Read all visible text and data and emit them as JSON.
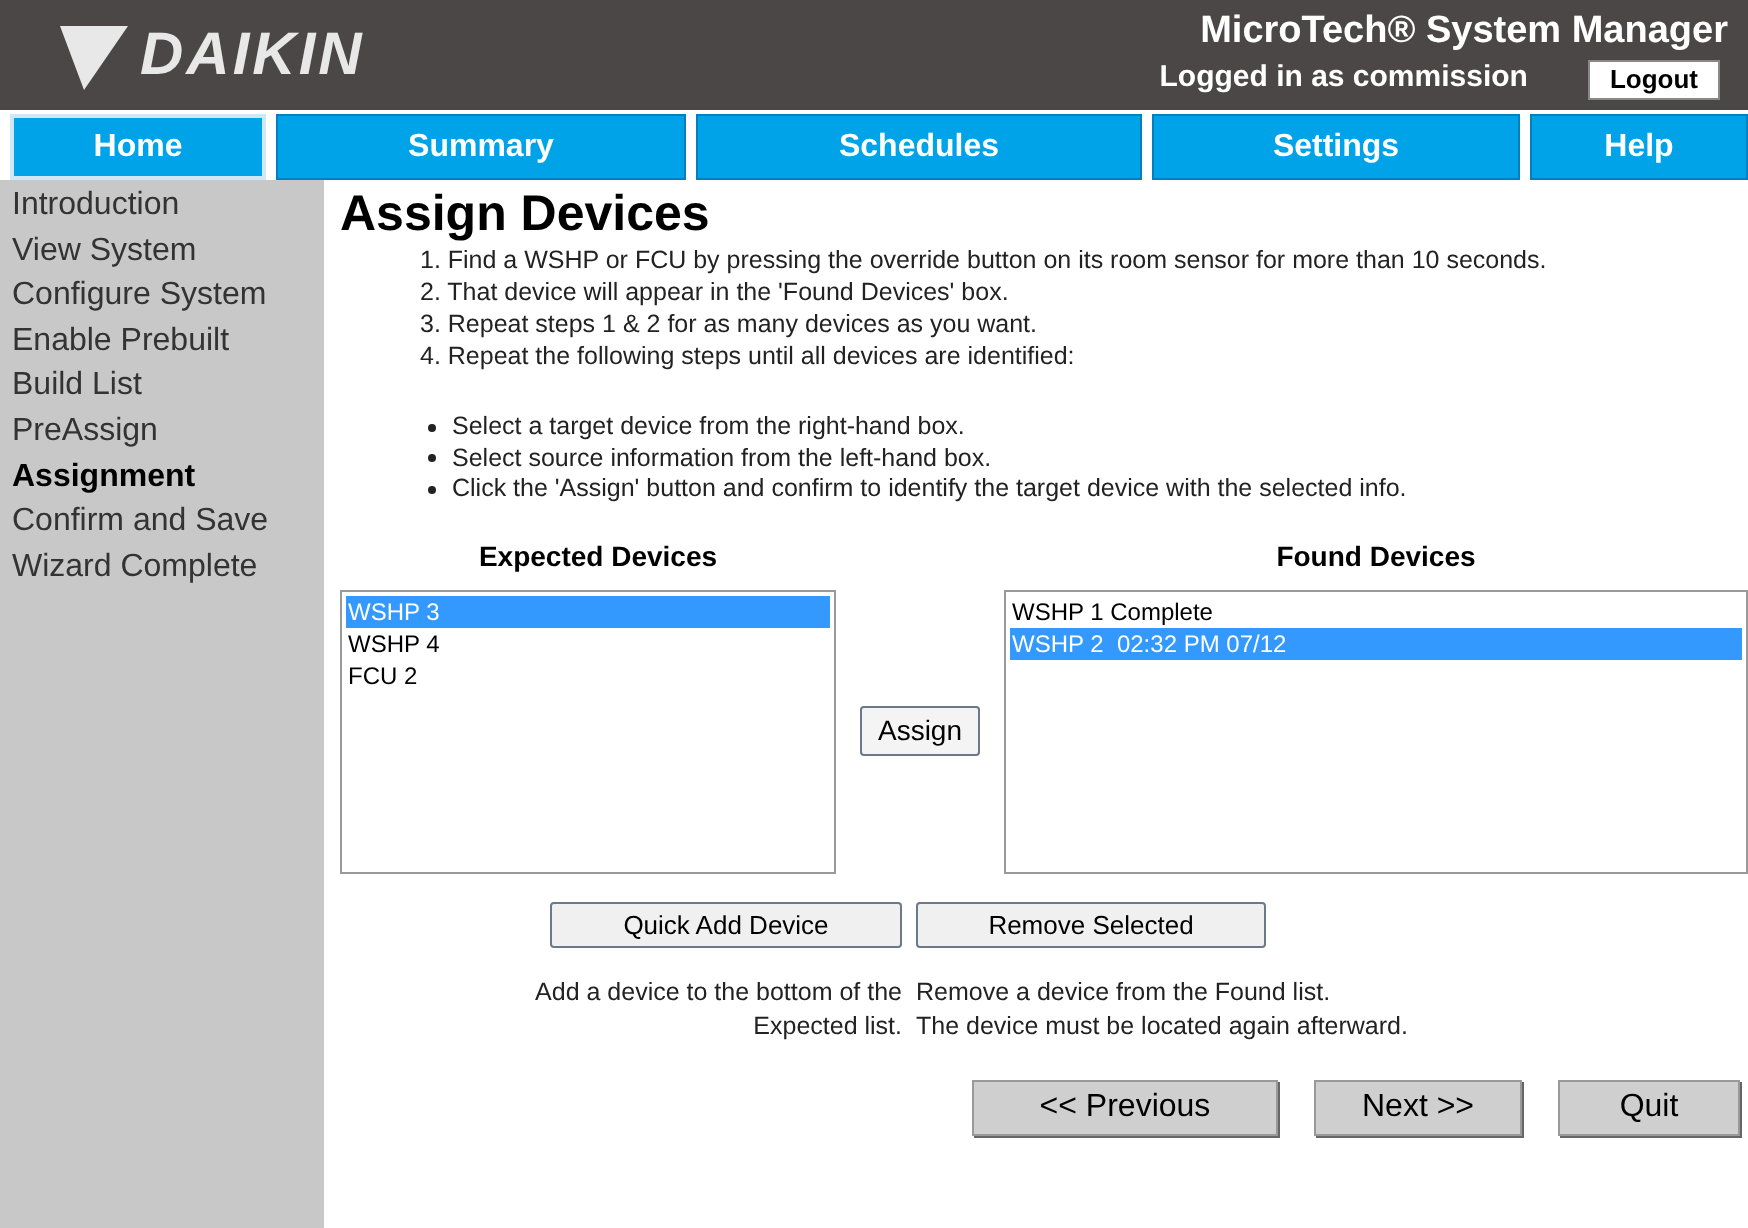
{
  "header": {
    "logo": "DAIKIN",
    "title": "MicroTech® System Manager",
    "login_status": "Logged in as commission",
    "logout_button": "Logout"
  },
  "nav_tabs": [
    {
      "label": "Home",
      "selected": true
    },
    {
      "label": "Summary",
      "selected": false
    },
    {
      "label": "Schedules",
      "selected": false
    },
    {
      "label": "Settings",
      "selected": false
    },
    {
      "label": "Help",
      "selected": false
    }
  ],
  "sidebar": {
    "items": [
      {
        "label": "Introduction",
        "selected": false
      },
      {
        "label": "View System",
        "selected": false
      },
      {
        "label": "Configure System",
        "selected": false
      },
      {
        "label": "Enable Prebuilt",
        "selected": false
      },
      {
        "label": "Build List",
        "selected": false
      },
      {
        "label": "PreAssign",
        "selected": false
      },
      {
        "label": "Assignment",
        "selected": true
      },
      {
        "label": "Confirm and Save",
        "selected": false
      },
      {
        "label": "Wizard Complete",
        "selected": false
      }
    ]
  },
  "page_title": "Assign Devices",
  "steps": [
    "1. Find a WSHP or FCU by pressing the override button on its room sensor for more than 10 seconds.",
    "2. That device will appear in the 'Found Devices' box.",
    "3. Repeat steps 1 & 2 for as many devices as you want.",
    "4. Repeat the following steps until all devices are identified:"
  ],
  "bullets": [
    "Select a target device from the right-hand box.",
    "Select source information from the left-hand box.",
    "Click the 'Assign' button and confirm to identify the target device with the selected info."
  ],
  "expected_devices": {
    "heading": "Expected Devices",
    "items": [
      {
        "label": "WSHP 3",
        "selected": true
      },
      {
        "label": "WSHP 4",
        "selected": false
      },
      {
        "label": "FCU 2",
        "selected": false
      }
    ]
  },
  "assign_button": "Assign",
  "found_devices": {
    "heading": "Found Devices",
    "items": [
      {
        "label": "WSHP 1 Complete",
        "selected": false
      },
      {
        "label": "WSHP 2  02:32 PM 07/12",
        "selected": true
      }
    ]
  },
  "quick_add": {
    "button": "Quick Add Device",
    "help": [
      "Add a device to the bottom of the",
      "Expected list."
    ]
  },
  "remove": {
    "button": "Remove Selected",
    "help": [
      "Remove a device from the Found list.",
      "The device must be located again afterward."
    ]
  },
  "footer_buttons": [
    "<< Previous",
    "Next >>",
    "Quit"
  ]
}
